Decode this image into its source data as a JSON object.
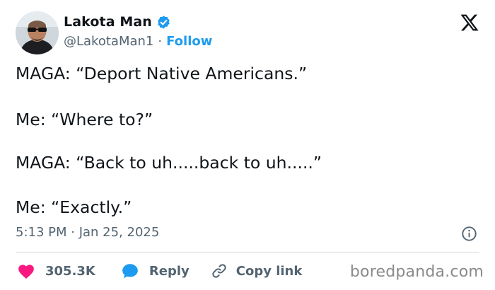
{
  "tweet": {
    "author": {
      "display_name": "Lakota Man",
      "handle": "@LakotaMan1",
      "separator": "·",
      "follow_label": "Follow",
      "verified": true
    },
    "lines": [
      "MAGA: “Deport Native Americans.”",
      "Me: “Where to?”",
      "MAGA: “Back to uh.....back to uh.....”",
      "Me: “Exactly.”"
    ],
    "timestamp": "5:13 PM · Jan 25, 2025"
  },
  "actions": {
    "likes": "305.3K",
    "reply_label": "Reply",
    "copy_label": "Copy link"
  },
  "watermark": "boredpanda.com",
  "icons": {
    "brand": "x-logo-icon",
    "verified": "verified-badge-icon",
    "info": "info-icon",
    "like": "heart-icon",
    "reply": "reply-bubble-icon",
    "copy": "link-icon"
  },
  "colors": {
    "accent": "#1d9bf0",
    "like": "#f91880",
    "muted": "#536471",
    "text": "#0f1419",
    "divider": "#cfd9de"
  }
}
